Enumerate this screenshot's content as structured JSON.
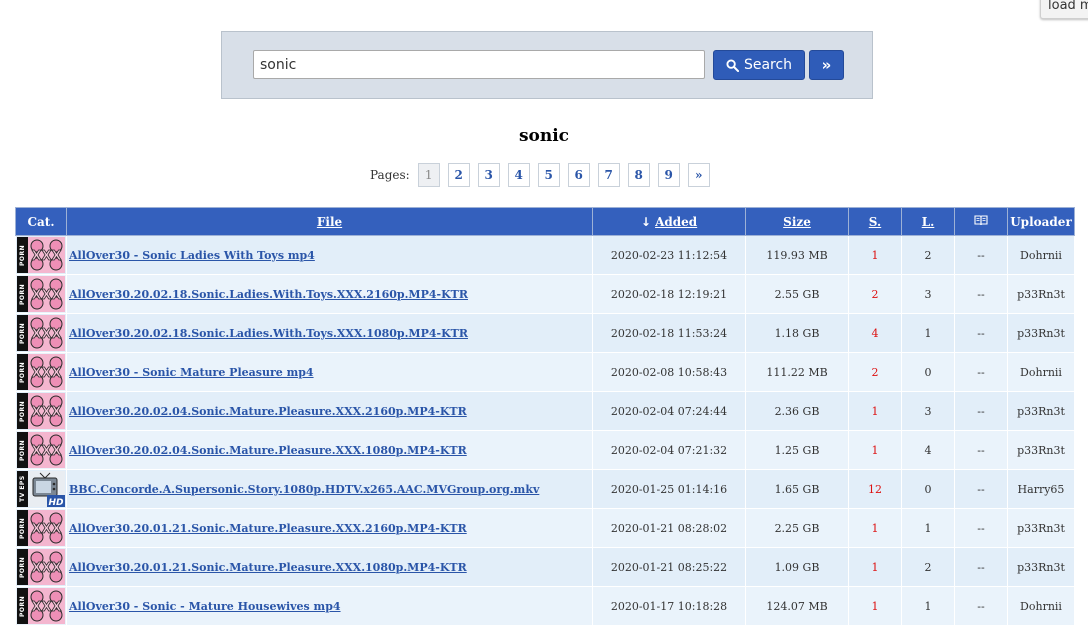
{
  "top_button": {
    "label": "load more"
  },
  "search": {
    "value": "sonic",
    "button_label": "Search",
    "more_label": "»"
  },
  "heading": "sonic",
  "pager": {
    "label": "Pages:",
    "pages": [
      "1",
      "2",
      "3",
      "4",
      "5",
      "6",
      "7",
      "8",
      "9",
      "»"
    ],
    "current": "1"
  },
  "table": {
    "headers": {
      "cat": "Cat.",
      "file": "File",
      "added_arrow": "↓",
      "added": "Added",
      "size": "Size",
      "seeders": "S.",
      "leechers": "L.",
      "comments_icon": "book-icon",
      "uploader": "Uploader"
    },
    "rows": [
      {
        "category": "PORN",
        "category_icon": "xxx-icon",
        "file": "AllOver30 - Sonic Ladies With Toys mp4",
        "added": "2020-02-23 11:12:54",
        "size": "119.93 MB",
        "seeders": "1",
        "leechers": "2",
        "comments": "--",
        "uploader": "Dohrnii"
      },
      {
        "category": "PORN",
        "category_icon": "xxx-icon",
        "file": "AllOver30.20.02.18.Sonic.Ladies.With.Toys.XXX.2160p.MP4-KTR",
        "added": "2020-02-18 12:19:21",
        "size": "2.55 GB",
        "seeders": "2",
        "leechers": "3",
        "comments": "--",
        "uploader": "p33Rn3t"
      },
      {
        "category": "PORN",
        "category_icon": "xxx-icon",
        "file": "AllOver30.20.02.18.Sonic.Ladies.With.Toys.XXX.1080p.MP4-KTR",
        "added": "2020-02-18 11:53:24",
        "size": "1.18 GB",
        "seeders": "4",
        "leechers": "1",
        "comments": "--",
        "uploader": "p33Rn3t"
      },
      {
        "category": "PORN",
        "category_icon": "xxx-icon",
        "file": "AllOver30 - Sonic Mature Pleasure mp4",
        "added": "2020-02-08 10:58:43",
        "size": "111.22 MB",
        "seeders": "2",
        "leechers": "0",
        "comments": "--",
        "uploader": "Dohrnii"
      },
      {
        "category": "PORN",
        "category_icon": "xxx-icon",
        "file": "AllOver30.20.02.04.Sonic.Mature.Pleasure.XXX.2160p.MP4-KTR",
        "added": "2020-02-04 07:24:44",
        "size": "2.36 GB",
        "seeders": "1",
        "leechers": "3",
        "comments": "--",
        "uploader": "p33Rn3t"
      },
      {
        "category": "PORN",
        "category_icon": "xxx-icon",
        "file": "AllOver30.20.02.04.Sonic.Mature.Pleasure.XXX.1080p.MP4-KTR",
        "added": "2020-02-04 07:21:32",
        "size": "1.25 GB",
        "seeders": "1",
        "leechers": "4",
        "comments": "--",
        "uploader": "p33Rn3t"
      },
      {
        "category": "TV EPS",
        "category_icon": "tv-hd-icon",
        "file": "BBC.Concorde.A.Supersonic.Story.1080p.HDTV.x265.AAC.MVGroup.org.mkv",
        "added": "2020-01-25 01:14:16",
        "size": "1.65 GB",
        "seeders": "12",
        "leechers": "0",
        "comments": "--",
        "uploader": "Harry65"
      },
      {
        "category": "PORN",
        "category_icon": "xxx-icon",
        "file": "AllOver30.20.01.21.Sonic.Mature.Pleasure.XXX.2160p.MP4-KTR",
        "added": "2020-01-21 08:28:02",
        "size": "2.25 GB",
        "seeders": "1",
        "leechers": "1",
        "comments": "--",
        "uploader": "p33Rn3t"
      },
      {
        "category": "PORN",
        "category_icon": "xxx-icon",
        "file": "AllOver30.20.01.21.Sonic.Mature.Pleasure.XXX.1080p.MP4-KTR",
        "added": "2020-01-21 08:25:22",
        "size": "1.09 GB",
        "seeders": "1",
        "leechers": "2",
        "comments": "--",
        "uploader": "p33Rn3t"
      },
      {
        "category": "PORN",
        "category_icon": "xxx-icon",
        "file": "AllOver30 - Sonic - Mature Housewives mp4",
        "added": "2020-01-17 10:18:28",
        "size": "124.07 MB",
        "seeders": "1",
        "leechers": "1",
        "comments": "--",
        "uploader": "Dohrnii"
      }
    ]
  },
  "colors": {
    "header_bg": "#3460bd",
    "button_bg": "#2f5cb8",
    "link": "#2a55a8",
    "seeders": "#dd1111",
    "row_odd": "#e2eef9",
    "row_even": "#eaf3fb"
  }
}
